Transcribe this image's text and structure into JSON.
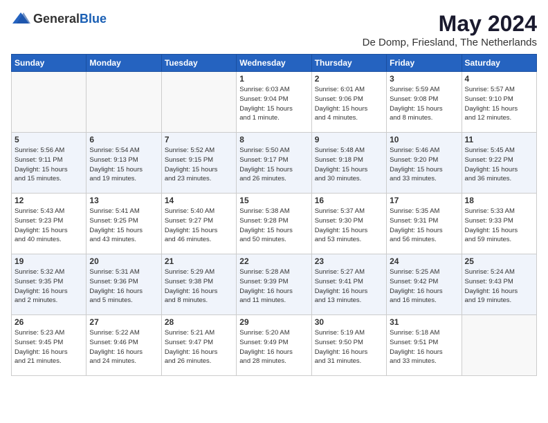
{
  "header": {
    "logo_general": "General",
    "logo_blue": "Blue",
    "title": "May 2024",
    "location": "De Domp, Friesland, The Netherlands"
  },
  "days_of_week": [
    "Sunday",
    "Monday",
    "Tuesday",
    "Wednesday",
    "Thursday",
    "Friday",
    "Saturday"
  ],
  "weeks": [
    [
      {
        "day": "",
        "info": ""
      },
      {
        "day": "",
        "info": ""
      },
      {
        "day": "",
        "info": ""
      },
      {
        "day": "1",
        "info": "Sunrise: 6:03 AM\nSunset: 9:04 PM\nDaylight: 15 hours\nand 1 minute."
      },
      {
        "day": "2",
        "info": "Sunrise: 6:01 AM\nSunset: 9:06 PM\nDaylight: 15 hours\nand 4 minutes."
      },
      {
        "day": "3",
        "info": "Sunrise: 5:59 AM\nSunset: 9:08 PM\nDaylight: 15 hours\nand 8 minutes."
      },
      {
        "day": "4",
        "info": "Sunrise: 5:57 AM\nSunset: 9:10 PM\nDaylight: 15 hours\nand 12 minutes."
      }
    ],
    [
      {
        "day": "5",
        "info": "Sunrise: 5:56 AM\nSunset: 9:11 PM\nDaylight: 15 hours\nand 15 minutes."
      },
      {
        "day": "6",
        "info": "Sunrise: 5:54 AM\nSunset: 9:13 PM\nDaylight: 15 hours\nand 19 minutes."
      },
      {
        "day": "7",
        "info": "Sunrise: 5:52 AM\nSunset: 9:15 PM\nDaylight: 15 hours\nand 23 minutes."
      },
      {
        "day": "8",
        "info": "Sunrise: 5:50 AM\nSunset: 9:17 PM\nDaylight: 15 hours\nand 26 minutes."
      },
      {
        "day": "9",
        "info": "Sunrise: 5:48 AM\nSunset: 9:18 PM\nDaylight: 15 hours\nand 30 minutes."
      },
      {
        "day": "10",
        "info": "Sunrise: 5:46 AM\nSunset: 9:20 PM\nDaylight: 15 hours\nand 33 minutes."
      },
      {
        "day": "11",
        "info": "Sunrise: 5:45 AM\nSunset: 9:22 PM\nDaylight: 15 hours\nand 36 minutes."
      }
    ],
    [
      {
        "day": "12",
        "info": "Sunrise: 5:43 AM\nSunset: 9:23 PM\nDaylight: 15 hours\nand 40 minutes."
      },
      {
        "day": "13",
        "info": "Sunrise: 5:41 AM\nSunset: 9:25 PM\nDaylight: 15 hours\nand 43 minutes."
      },
      {
        "day": "14",
        "info": "Sunrise: 5:40 AM\nSunset: 9:27 PM\nDaylight: 15 hours\nand 46 minutes."
      },
      {
        "day": "15",
        "info": "Sunrise: 5:38 AM\nSunset: 9:28 PM\nDaylight: 15 hours\nand 50 minutes."
      },
      {
        "day": "16",
        "info": "Sunrise: 5:37 AM\nSunset: 9:30 PM\nDaylight: 15 hours\nand 53 minutes."
      },
      {
        "day": "17",
        "info": "Sunrise: 5:35 AM\nSunset: 9:31 PM\nDaylight: 15 hours\nand 56 minutes."
      },
      {
        "day": "18",
        "info": "Sunrise: 5:33 AM\nSunset: 9:33 PM\nDaylight: 15 hours\nand 59 minutes."
      }
    ],
    [
      {
        "day": "19",
        "info": "Sunrise: 5:32 AM\nSunset: 9:35 PM\nDaylight: 16 hours\nand 2 minutes."
      },
      {
        "day": "20",
        "info": "Sunrise: 5:31 AM\nSunset: 9:36 PM\nDaylight: 16 hours\nand 5 minutes."
      },
      {
        "day": "21",
        "info": "Sunrise: 5:29 AM\nSunset: 9:38 PM\nDaylight: 16 hours\nand 8 minutes."
      },
      {
        "day": "22",
        "info": "Sunrise: 5:28 AM\nSunset: 9:39 PM\nDaylight: 16 hours\nand 11 minutes."
      },
      {
        "day": "23",
        "info": "Sunrise: 5:27 AM\nSunset: 9:41 PM\nDaylight: 16 hours\nand 13 minutes."
      },
      {
        "day": "24",
        "info": "Sunrise: 5:25 AM\nSunset: 9:42 PM\nDaylight: 16 hours\nand 16 minutes."
      },
      {
        "day": "25",
        "info": "Sunrise: 5:24 AM\nSunset: 9:43 PM\nDaylight: 16 hours\nand 19 minutes."
      }
    ],
    [
      {
        "day": "26",
        "info": "Sunrise: 5:23 AM\nSunset: 9:45 PM\nDaylight: 16 hours\nand 21 minutes."
      },
      {
        "day": "27",
        "info": "Sunrise: 5:22 AM\nSunset: 9:46 PM\nDaylight: 16 hours\nand 24 minutes."
      },
      {
        "day": "28",
        "info": "Sunrise: 5:21 AM\nSunset: 9:47 PM\nDaylight: 16 hours\nand 26 minutes."
      },
      {
        "day": "29",
        "info": "Sunrise: 5:20 AM\nSunset: 9:49 PM\nDaylight: 16 hours\nand 28 minutes."
      },
      {
        "day": "30",
        "info": "Sunrise: 5:19 AM\nSunset: 9:50 PM\nDaylight: 16 hours\nand 31 minutes."
      },
      {
        "day": "31",
        "info": "Sunrise: 5:18 AM\nSunset: 9:51 PM\nDaylight: 16 hours\nand 33 minutes."
      },
      {
        "day": "",
        "info": ""
      }
    ]
  ]
}
